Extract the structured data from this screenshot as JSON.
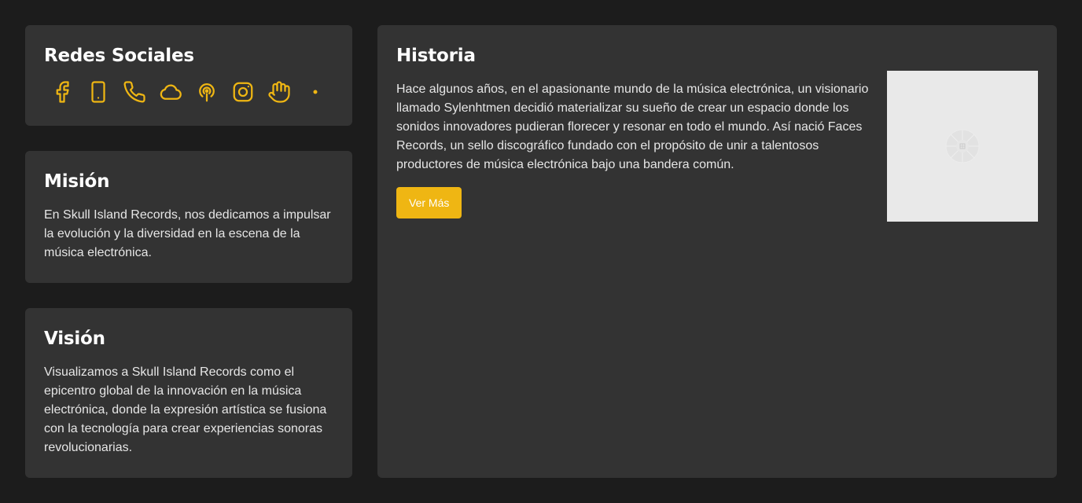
{
  "social": {
    "title": "Redes Sociales",
    "icons": [
      "facebook-icon",
      "mobile-icon",
      "phone-icon",
      "cloud-icon",
      "podcast-icon",
      "instagram-icon",
      "hand-icon",
      "dot-icon"
    ],
    "accent": "#efb613"
  },
  "mision": {
    "title": "Misión",
    "text": "En Skull Island Records, nos dedicamos a impulsar la evolución y la diversidad en la escena de la música electrónica."
  },
  "vision": {
    "title": "Visión",
    "text": "Visualizamos a Skull Island Records como el epicentro global de la innovación en la música electrónica, donde la expresión artística se fusiona con la tecnología para crear experiencias sonoras revolucionarias."
  },
  "historia": {
    "title": "Historia",
    "text": "Hace algunos años, en el apasionante mundo de la música electrónica, un visionario llamado Sylenhtmen decidió materializar su sueño de crear un espacio donde los sonidos innovadores pudieran florecer y resonar en todo el mundo. Así nació Faces Records, un sello discográfico fundado con el propósito de unir a talentosos productores de música electrónica bajo una bandera común.",
    "button_label": "Ver Más"
  },
  "colors": {
    "background": "#1c1c1c",
    "card": "#333333",
    "accent": "#efb613"
  }
}
